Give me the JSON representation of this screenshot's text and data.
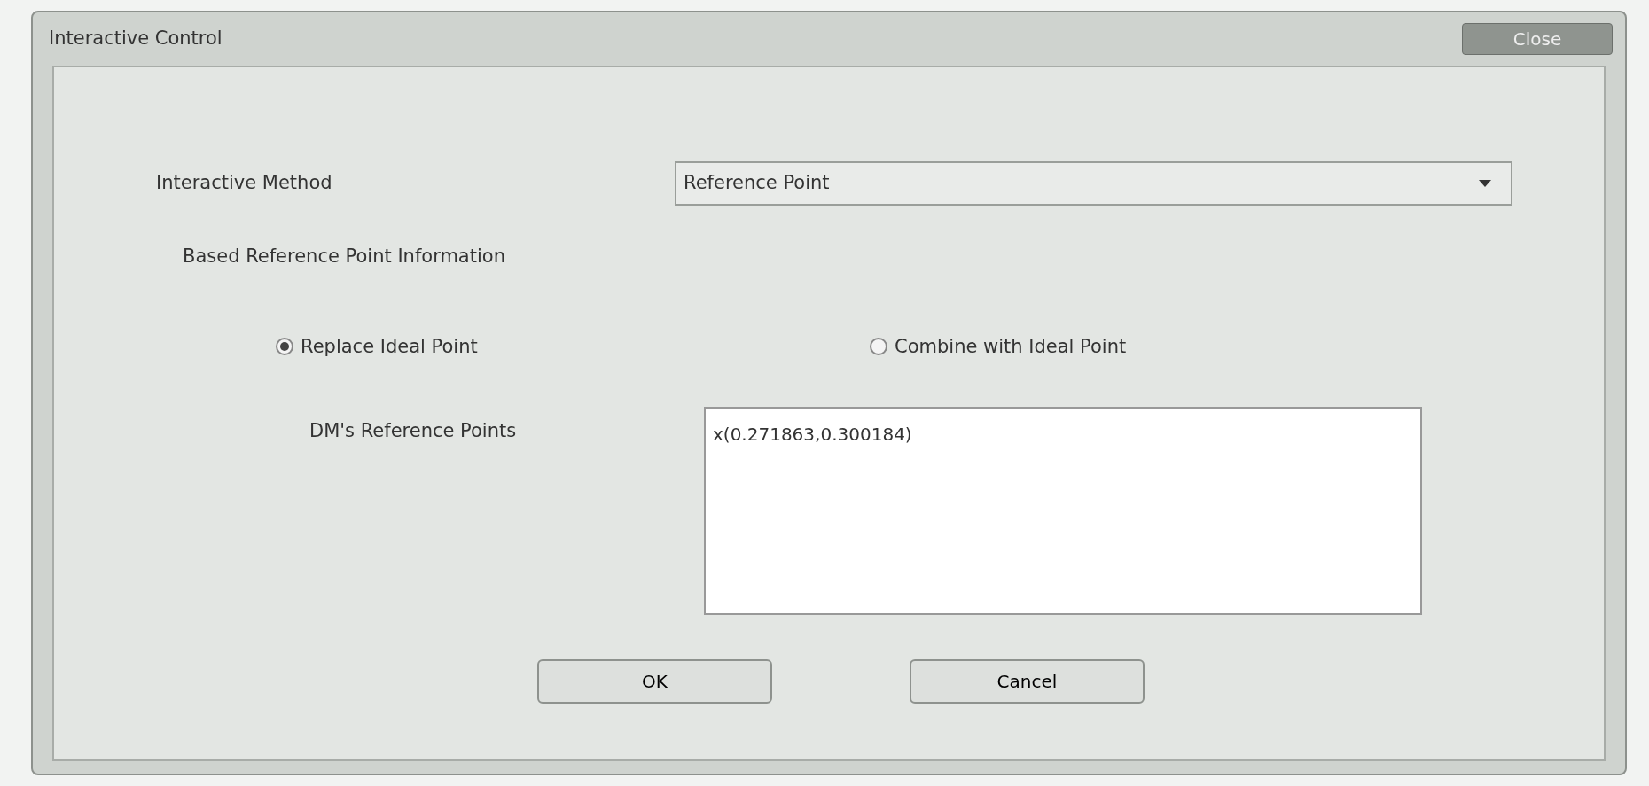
{
  "window": {
    "title": "Interactive Control",
    "close_label": "Close"
  },
  "method": {
    "label": "Interactive Method",
    "value": "Reference Point"
  },
  "section_label": "Based Reference Point Information",
  "options": [
    {
      "label": "Replace Ideal Point",
      "selected": true
    },
    {
      "label": "Combine with Ideal Point",
      "selected": false
    }
  ],
  "reference_points": {
    "label": "DM's Reference Points",
    "value": "x(0.271863,0.300184)"
  },
  "buttons": [
    "OK",
    "Cancel"
  ]
}
